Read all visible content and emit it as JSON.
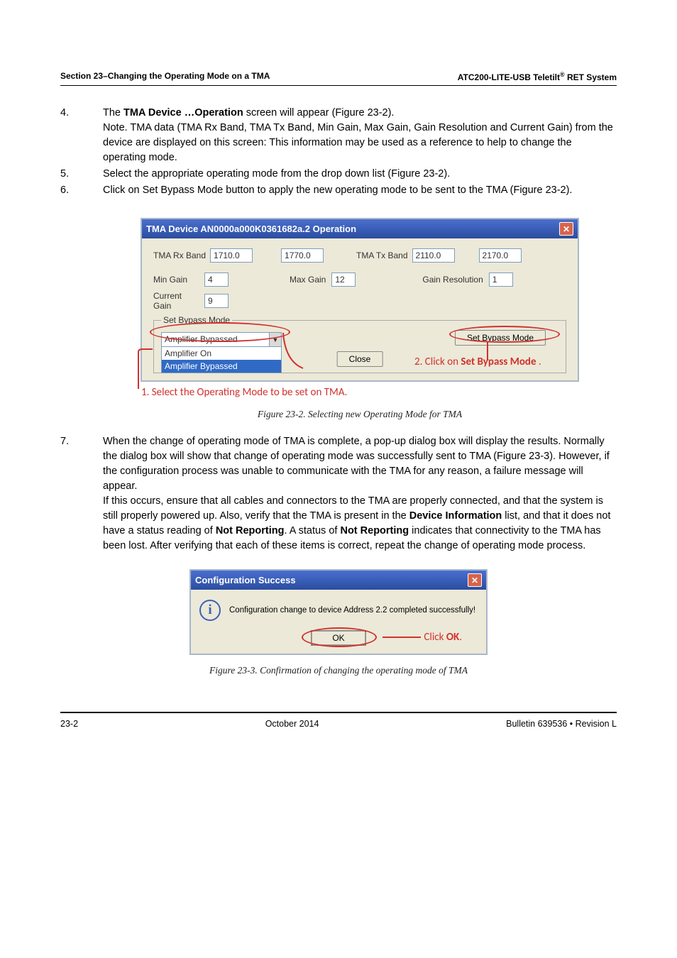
{
  "header": {
    "left": "Section 23–Changing the Operating Mode on a TMA",
    "right_prefix": "ATC200-LITE-USB Teletilt",
    "right_suffix": " RET System"
  },
  "steps_a": [
    {
      "n": "4.",
      "html": "The <b>TMA Device …Operation</b> screen will appear (Figure 23-2).<br>Note.  TMA data (TMA Rx Band, TMA Tx Band, Min Gain, Max Gain, Gain Resolution and Current Gain) from the device are displayed on this screen: This information may be used as a reference to help to change the operating mode."
    },
    {
      "n": "5.",
      "html": "Select the appropriate operating mode from the drop down list (Figure 23-2)."
    },
    {
      "n": "6.",
      "html": "Click on Set Bypass Mode button to apply the new operating mode to be sent to the TMA (Figure 23-2)."
    }
  ],
  "dialog1": {
    "title": "TMA Device AN0000a000K0361682a.2 Operation",
    "rx_label": "TMA Rx Band",
    "rx_lo": "1710.0",
    "rx_hi": "1770.0",
    "tx_label": "TMA Tx Band",
    "tx_lo": "2110.0",
    "tx_hi": "2170.0",
    "min_gain_label": "Min Gain",
    "min_gain": "4",
    "max_gain_label": "Max Gain",
    "max_gain": "12",
    "gain_res_label": "Gain Resolution",
    "gain_res": "1",
    "current_gain_label": "Current Gain",
    "current_gain": "9",
    "set_bypass_legend": "Set Bypass Mode",
    "combo_selected": "Amplifier Bypassed",
    "combo_options": [
      "Amplifier On",
      "Amplifier Bypassed"
    ],
    "set_bypass_btn": "Set Bypass Mode",
    "close_btn": "Close"
  },
  "anno1": {
    "step1": "1.  Select the Operating Mode to be set on TMA.",
    "step2a": "2.  Click on ",
    "step2b_bold": "Set Bypass Mode",
    "step2c": " ."
  },
  "fig1_caption": "Figure 23-2. Selecting new Operating Mode for TMA",
  "steps_b": [
    {
      "n": "7.",
      "html": "When the change of operating mode of TMA is complete, a pop-up dialog box will display the results. Normally the dialog box will show that change of operating mode was successfully sent to TMA (Figure 23-3). However, if the configuration process was unable to communicate with the TMA for any reason, a failure message will appear.<br>If this occurs, ensure that all cables and connectors to the TMA are properly connected, and that the system is still properly powered up. Also, verify that the TMA is present in the <b>Device Information</b> list, and that it does not have a status reading of <b>Not Reporting</b>. A status of <b>Not Reporting</b> indicates that connectivity to the TMA has been lost. After verifying that each of these items is correct, repeat the change of operating mode process."
    }
  ],
  "dialog2": {
    "title": "Configuration Success",
    "message": "Configuration change to device Address 2.2 completed successfully!",
    "ok": "OK"
  },
  "anno2": {
    "click_ok_a": "Click ",
    "click_ok_b": "OK",
    "click_ok_c": "."
  },
  "fig2_caption": "Figure 23-3. Confirmation of changing the operating mode of TMA",
  "footer": {
    "left": "23-2",
    "center": "October 2014",
    "right": "Bulletin 639536  •  Revision L"
  }
}
